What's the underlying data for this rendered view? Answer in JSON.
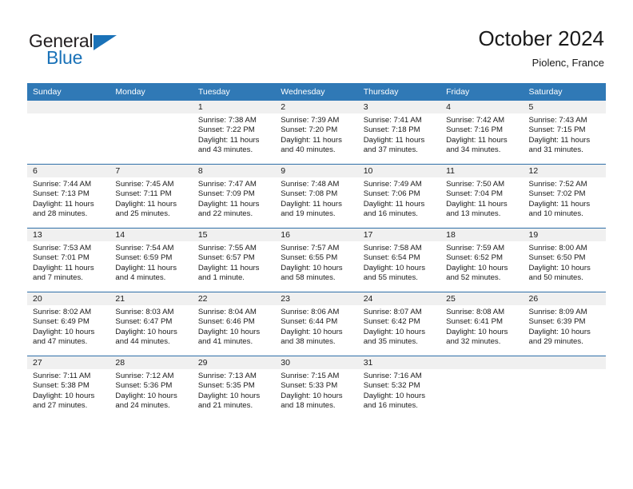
{
  "brand": {
    "name_part1": "General",
    "name_part2": "Blue",
    "triangle_color": "#1a72b8"
  },
  "header": {
    "title": "October 2024",
    "subtitle": "Piolenc, France"
  },
  "theme": {
    "header_blue": "#3079b6",
    "row_divider_blue": "#2f6fa8",
    "day_band_gray": "#f0f0f0"
  },
  "weekday_headers": [
    "Sunday",
    "Monday",
    "Tuesday",
    "Wednesday",
    "Thursday",
    "Friday",
    "Saturday"
  ],
  "labels": {
    "sunrise_prefix": "Sunrise:",
    "sunset_prefix": "Sunset:",
    "daylight_prefix": "Daylight:"
  },
  "weeks": [
    [
      {
        "day": "",
        "sunrise": "",
        "sunset": "",
        "daylight": "",
        "empty": true
      },
      {
        "day": "",
        "sunrise": "",
        "sunset": "",
        "daylight": "",
        "empty": true
      },
      {
        "day": "1",
        "sunrise": "Sunrise: 7:38 AM",
        "sunset": "Sunset: 7:22 PM",
        "daylight": "Daylight: 11 hours and 43 minutes."
      },
      {
        "day": "2",
        "sunrise": "Sunrise: 7:39 AM",
        "sunset": "Sunset: 7:20 PM",
        "daylight": "Daylight: 11 hours and 40 minutes."
      },
      {
        "day": "3",
        "sunrise": "Sunrise: 7:41 AM",
        "sunset": "Sunset: 7:18 PM",
        "daylight": "Daylight: 11 hours and 37 minutes."
      },
      {
        "day": "4",
        "sunrise": "Sunrise: 7:42 AM",
        "sunset": "Sunset: 7:16 PM",
        "daylight": "Daylight: 11 hours and 34 minutes."
      },
      {
        "day": "5",
        "sunrise": "Sunrise: 7:43 AM",
        "sunset": "Sunset: 7:15 PM",
        "daylight": "Daylight: 11 hours and 31 minutes."
      }
    ],
    [
      {
        "day": "6",
        "sunrise": "Sunrise: 7:44 AM",
        "sunset": "Sunset: 7:13 PM",
        "daylight": "Daylight: 11 hours and 28 minutes."
      },
      {
        "day": "7",
        "sunrise": "Sunrise: 7:45 AM",
        "sunset": "Sunset: 7:11 PM",
        "daylight": "Daylight: 11 hours and 25 minutes."
      },
      {
        "day": "8",
        "sunrise": "Sunrise: 7:47 AM",
        "sunset": "Sunset: 7:09 PM",
        "daylight": "Daylight: 11 hours and 22 minutes."
      },
      {
        "day": "9",
        "sunrise": "Sunrise: 7:48 AM",
        "sunset": "Sunset: 7:08 PM",
        "daylight": "Daylight: 11 hours and 19 minutes."
      },
      {
        "day": "10",
        "sunrise": "Sunrise: 7:49 AM",
        "sunset": "Sunset: 7:06 PM",
        "daylight": "Daylight: 11 hours and 16 minutes."
      },
      {
        "day": "11",
        "sunrise": "Sunrise: 7:50 AM",
        "sunset": "Sunset: 7:04 PM",
        "daylight": "Daylight: 11 hours and 13 minutes."
      },
      {
        "day": "12",
        "sunrise": "Sunrise: 7:52 AM",
        "sunset": "Sunset: 7:02 PM",
        "daylight": "Daylight: 11 hours and 10 minutes."
      }
    ],
    [
      {
        "day": "13",
        "sunrise": "Sunrise: 7:53 AM",
        "sunset": "Sunset: 7:01 PM",
        "daylight": "Daylight: 11 hours and 7 minutes."
      },
      {
        "day": "14",
        "sunrise": "Sunrise: 7:54 AM",
        "sunset": "Sunset: 6:59 PM",
        "daylight": "Daylight: 11 hours and 4 minutes."
      },
      {
        "day": "15",
        "sunrise": "Sunrise: 7:55 AM",
        "sunset": "Sunset: 6:57 PM",
        "daylight": "Daylight: 11 hours and 1 minute."
      },
      {
        "day": "16",
        "sunrise": "Sunrise: 7:57 AM",
        "sunset": "Sunset: 6:55 PM",
        "daylight": "Daylight: 10 hours and 58 minutes."
      },
      {
        "day": "17",
        "sunrise": "Sunrise: 7:58 AM",
        "sunset": "Sunset: 6:54 PM",
        "daylight": "Daylight: 10 hours and 55 minutes."
      },
      {
        "day": "18",
        "sunrise": "Sunrise: 7:59 AM",
        "sunset": "Sunset: 6:52 PM",
        "daylight": "Daylight: 10 hours and 52 minutes."
      },
      {
        "day": "19",
        "sunrise": "Sunrise: 8:00 AM",
        "sunset": "Sunset: 6:50 PM",
        "daylight": "Daylight: 10 hours and 50 minutes."
      }
    ],
    [
      {
        "day": "20",
        "sunrise": "Sunrise: 8:02 AM",
        "sunset": "Sunset: 6:49 PM",
        "daylight": "Daylight: 10 hours and 47 minutes."
      },
      {
        "day": "21",
        "sunrise": "Sunrise: 8:03 AM",
        "sunset": "Sunset: 6:47 PM",
        "daylight": "Daylight: 10 hours and 44 minutes."
      },
      {
        "day": "22",
        "sunrise": "Sunrise: 8:04 AM",
        "sunset": "Sunset: 6:46 PM",
        "daylight": "Daylight: 10 hours and 41 minutes."
      },
      {
        "day": "23",
        "sunrise": "Sunrise: 8:06 AM",
        "sunset": "Sunset: 6:44 PM",
        "daylight": "Daylight: 10 hours and 38 minutes."
      },
      {
        "day": "24",
        "sunrise": "Sunrise: 8:07 AM",
        "sunset": "Sunset: 6:42 PM",
        "daylight": "Daylight: 10 hours and 35 minutes."
      },
      {
        "day": "25",
        "sunrise": "Sunrise: 8:08 AM",
        "sunset": "Sunset: 6:41 PM",
        "daylight": "Daylight: 10 hours and 32 minutes."
      },
      {
        "day": "26",
        "sunrise": "Sunrise: 8:09 AM",
        "sunset": "Sunset: 6:39 PM",
        "daylight": "Daylight: 10 hours and 29 minutes."
      }
    ],
    [
      {
        "day": "27",
        "sunrise": "Sunrise: 7:11 AM",
        "sunset": "Sunset: 5:38 PM",
        "daylight": "Daylight: 10 hours and 27 minutes."
      },
      {
        "day": "28",
        "sunrise": "Sunrise: 7:12 AM",
        "sunset": "Sunset: 5:36 PM",
        "daylight": "Daylight: 10 hours and 24 minutes."
      },
      {
        "day": "29",
        "sunrise": "Sunrise: 7:13 AM",
        "sunset": "Sunset: 5:35 PM",
        "daylight": "Daylight: 10 hours and 21 minutes."
      },
      {
        "day": "30",
        "sunrise": "Sunrise: 7:15 AM",
        "sunset": "Sunset: 5:33 PM",
        "daylight": "Daylight: 10 hours and 18 minutes."
      },
      {
        "day": "31",
        "sunrise": "Sunrise: 7:16 AM",
        "sunset": "Sunset: 5:32 PM",
        "daylight": "Daylight: 10 hours and 16 minutes."
      },
      {
        "day": "",
        "sunrise": "",
        "sunset": "",
        "daylight": "",
        "empty": true
      },
      {
        "day": "",
        "sunrise": "",
        "sunset": "",
        "daylight": "",
        "empty": true
      }
    ]
  ]
}
